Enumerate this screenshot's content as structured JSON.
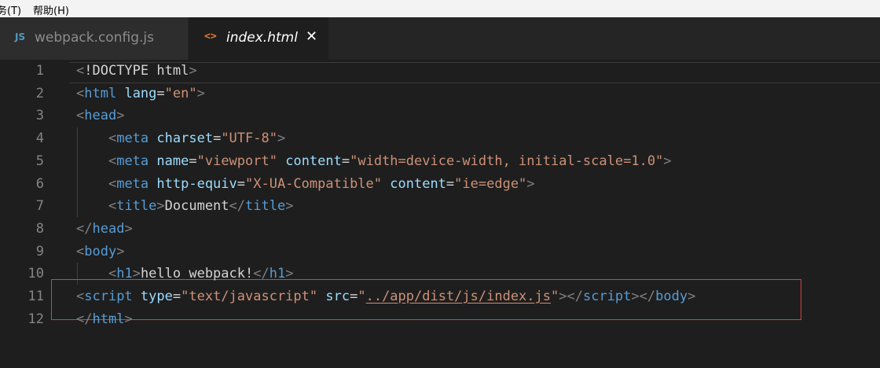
{
  "menubar": {
    "items": [
      "务(T)",
      "帮助(H)"
    ]
  },
  "tabs": [
    {
      "icon": "JS",
      "label": "webpack.config.js",
      "active": false
    },
    {
      "icon": "<>",
      "label": "index.html",
      "active": true,
      "close": "✕"
    }
  ],
  "editor": {
    "lines": [
      {
        "n": "1",
        "tokens": [
          [
            "p",
            "<"
          ],
          [
            "t",
            "!DOCTYPE html"
          ],
          [
            "p",
            ">"
          ]
        ]
      },
      {
        "n": "2",
        "tokens": [
          [
            "p",
            "<"
          ],
          [
            "k",
            "html"
          ],
          [
            "t",
            " "
          ],
          [
            "a",
            "lang"
          ],
          [
            "t",
            "="
          ],
          [
            "s",
            "\"en\""
          ],
          [
            "p",
            ">"
          ]
        ]
      },
      {
        "n": "3",
        "tokens": [
          [
            "p",
            "<"
          ],
          [
            "k",
            "head"
          ],
          [
            "p",
            ">"
          ]
        ]
      },
      {
        "n": "4",
        "tokens": [
          [
            "t",
            "    "
          ],
          [
            "p",
            "<"
          ],
          [
            "k",
            "meta"
          ],
          [
            "t",
            " "
          ],
          [
            "a",
            "charset"
          ],
          [
            "t",
            "="
          ],
          [
            "s",
            "\"UTF-8\""
          ],
          [
            "p",
            ">"
          ]
        ]
      },
      {
        "n": "5",
        "tokens": [
          [
            "t",
            "    "
          ],
          [
            "p",
            "<"
          ],
          [
            "k",
            "meta"
          ],
          [
            "t",
            " "
          ],
          [
            "a",
            "name"
          ],
          [
            "t",
            "="
          ],
          [
            "s",
            "\"viewport\""
          ],
          [
            "t",
            " "
          ],
          [
            "a",
            "content"
          ],
          [
            "t",
            "="
          ],
          [
            "s",
            "\"width=device-width, initial-scale=1.0\""
          ],
          [
            "p",
            ">"
          ]
        ]
      },
      {
        "n": "6",
        "tokens": [
          [
            "t",
            "    "
          ],
          [
            "p",
            "<"
          ],
          [
            "k",
            "meta"
          ],
          [
            "t",
            " "
          ],
          [
            "a",
            "http-equiv"
          ],
          [
            "t",
            "="
          ],
          [
            "s",
            "\"X-UA-Compatible\""
          ],
          [
            "t",
            " "
          ],
          [
            "a",
            "content"
          ],
          [
            "t",
            "="
          ],
          [
            "s",
            "\"ie=edge\""
          ],
          [
            "p",
            ">"
          ]
        ]
      },
      {
        "n": "7",
        "tokens": [
          [
            "t",
            "    "
          ],
          [
            "p",
            "<"
          ],
          [
            "k",
            "title"
          ],
          [
            "p",
            ">"
          ],
          [
            "t",
            "Document"
          ],
          [
            "p",
            "</"
          ],
          [
            "k",
            "title"
          ],
          [
            "p",
            ">"
          ]
        ]
      },
      {
        "n": "8",
        "tokens": [
          [
            "p",
            "</"
          ],
          [
            "k",
            "head"
          ],
          [
            "p",
            ">"
          ]
        ]
      },
      {
        "n": "9",
        "tokens": [
          [
            "p",
            "<"
          ],
          [
            "k",
            "body"
          ],
          [
            "p",
            ">"
          ]
        ]
      },
      {
        "n": "10",
        "tokens": [
          [
            "t",
            "    "
          ],
          [
            "p",
            "<"
          ],
          [
            "k",
            "h1"
          ],
          [
            "p",
            ">"
          ],
          [
            "t",
            "hello webpack!"
          ],
          [
            "p",
            "</"
          ],
          [
            "k",
            "h1"
          ],
          [
            "p",
            ">"
          ]
        ]
      },
      {
        "n": "11",
        "tokens": [
          [
            "p",
            "<"
          ],
          [
            "k",
            "script"
          ],
          [
            "t",
            " "
          ],
          [
            "a",
            "type"
          ],
          [
            "t",
            "="
          ],
          [
            "s",
            "\"text/javascript\""
          ],
          [
            "t",
            " "
          ],
          [
            "a",
            "src"
          ],
          [
            "t",
            "="
          ],
          [
            "s",
            "\""
          ],
          [
            "u",
            "../app/dist/js/index.js"
          ],
          [
            "s",
            "\""
          ],
          [
            "p",
            "></"
          ],
          [
            "k",
            "script"
          ],
          [
            "p",
            "></"
          ],
          [
            "k",
            "body"
          ],
          [
            "p",
            ">"
          ]
        ]
      },
      {
        "n": "12",
        "tokens": [
          [
            "p",
            "</"
          ],
          [
            "k",
            "html"
          ],
          [
            "p",
            ">"
          ]
        ]
      }
    ]
  },
  "colors": {
    "editor_bg": "#1e1e1e",
    "tag": "#569cd6",
    "attr": "#9cdcfe",
    "string": "#ce9178",
    "highlight_box": "#e03c3c"
  }
}
